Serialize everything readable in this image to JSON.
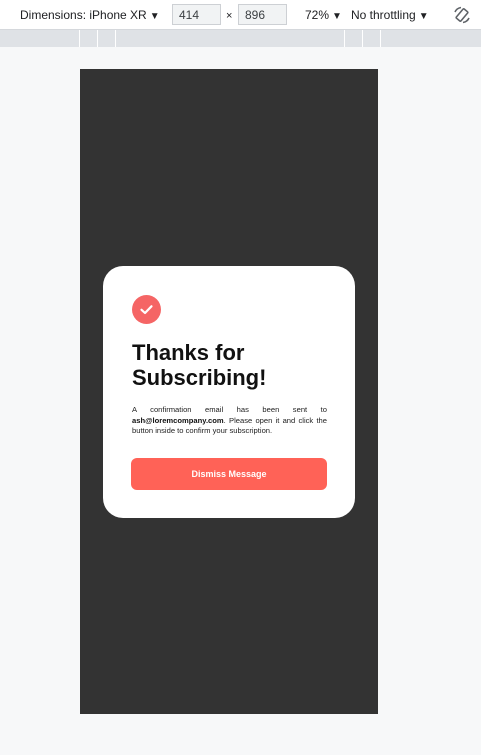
{
  "toolbar": {
    "dimensions_label": "Dimensions: iPhone XR",
    "width_value": "414",
    "height_value": "896",
    "times_symbol": "×",
    "zoom_label": "72%",
    "throttling_label": "No throttling"
  },
  "icons": {
    "rotate": "rotate-icon",
    "check": "check-icon",
    "dropdown": "caret-down-icon"
  },
  "card": {
    "title": "Thanks for Subscribing!",
    "message_before": "A confirmation email has been sent to ",
    "email": "ash@loremcompany.com",
    "message_after": ". Please open it and click the button inside to confirm your subscription.",
    "dismiss_label": "Dismiss Message"
  },
  "colors": {
    "device_background": "#333333",
    "card_background": "#ffffff",
    "accent": "#ff6257",
    "check_circle": "#f56565"
  }
}
